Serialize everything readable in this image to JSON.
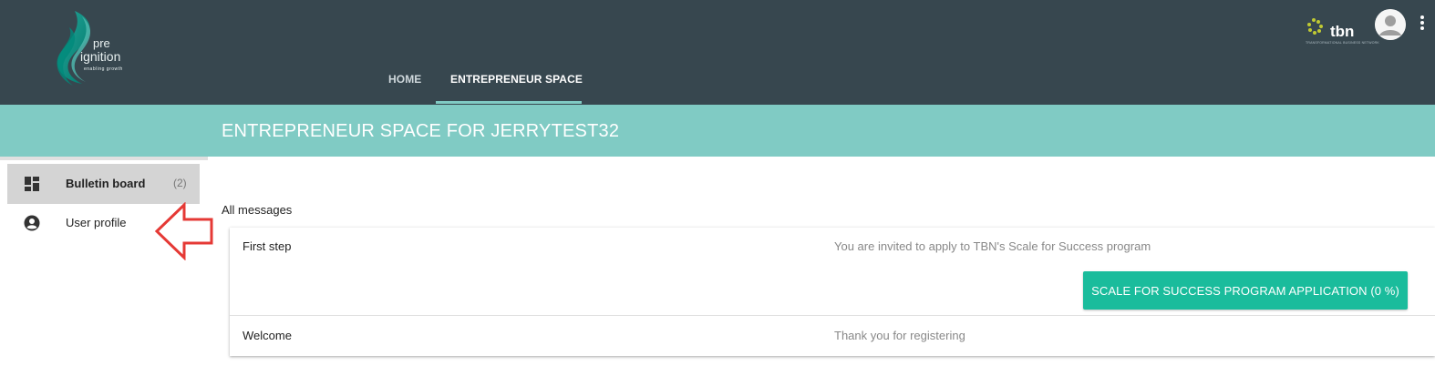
{
  "header": {
    "logo": {
      "line1": "pre",
      "line2": "ignition",
      "tagline": "enabling growth"
    },
    "tabs": [
      {
        "label": "HOME",
        "active": false
      },
      {
        "label": "ENTREPRENEUR SPACE",
        "active": true
      }
    ],
    "partner_logo": {
      "text": "tbn",
      "subtext": "TRANSFORMATIONAL BUSINESS NETWORK"
    },
    "user_menu": {
      "avatar_icon": "account-circle-icon",
      "more_icon": "more-vert-icon"
    }
  },
  "banner": {
    "title": "ENTREPRENEUR SPACE FOR JERRYTEST32"
  },
  "sidebar": {
    "items": [
      {
        "label": "Bulletin board",
        "count": "(2)",
        "icon": "dashboard-icon",
        "active": true
      },
      {
        "label": "User profile",
        "count": "",
        "icon": "account-circle-icon",
        "active": false
      }
    ]
  },
  "annotation": {
    "icon": "left-arrow-outline-icon",
    "color": "#e53935"
  },
  "main": {
    "section_label": "All messages",
    "messages": [
      {
        "title": "First step",
        "text": "You are invited to apply to TBN's Scale for Success program",
        "action_label": "SCALE FOR SUCCESS PROGRAM APPLICATION (0 %)"
      },
      {
        "title": "Welcome",
        "text": "Thank you for registering"
      }
    ]
  },
  "colors": {
    "header_bg": "#37474f",
    "banner_bg": "#80cbc4",
    "accent": "#1abc9c",
    "sidebar_active_bg": "#d4d4d4"
  }
}
